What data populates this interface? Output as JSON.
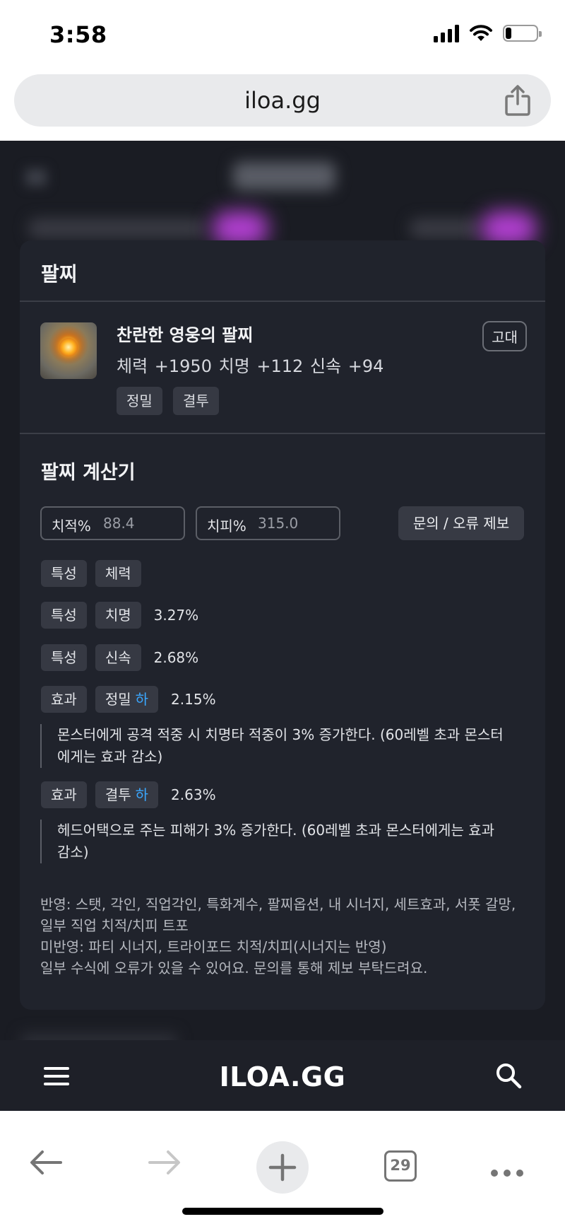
{
  "status_bar": {
    "time": "3:58",
    "battery_level": 0.2
  },
  "browser": {
    "url": "iloa.gg",
    "tab_count": "29"
  },
  "modal": {
    "title": "팔찌",
    "item": {
      "name": "찬란한 영웅의 팔찌",
      "stats": "체력 +1950  치명 +112  신속 +94",
      "grade": "고대",
      "tags": [
        "정밀",
        "결투"
      ]
    },
    "calculator": {
      "title": "팔찌 계산기",
      "crit_rate_label": "치적%",
      "crit_rate_value": "88.4",
      "crit_damage_label": "치피%",
      "crit_damage_value": "315.0",
      "report_button": "문의 / 오류 제보"
    },
    "rows": [
      {
        "type": "특성",
        "name": "체력",
        "value": ""
      },
      {
        "type": "특성",
        "name": "치명",
        "value": "3.27%"
      },
      {
        "type": "특성",
        "name": "신속",
        "value": "2.68%"
      },
      {
        "type": "효과",
        "name": "정밀",
        "grade": "하",
        "value": "2.15%",
        "description": "몬스터에게 공격 적중 시 치명타 적중이 3% 증가한다. (60레벨 초과 몬스터에게는 효과 감소)"
      },
      {
        "type": "효과",
        "name": "결투",
        "grade": "하",
        "value": "2.63%",
        "description": "헤드어택으로 주는 피해가 3% 증가한다. (60레벨 초과 몬스터에게는 효과 감소)"
      }
    ],
    "footnotes": {
      "applied": "반영: 스탯, 각인, 직업각인, 특화계수, 팔찌옵션, 내 시너지, 세트효과, 서폿 갈망, 일부 직업 치적/치피 트포",
      "not_applied": "미반영: 파티 시너지, 트라이포드 치적/치피(시너지는 반영)",
      "error_note": "일부 수식에 오류가 있을 수 있어요. 문의를 통해 제보 부탁드려요."
    }
  },
  "site_nav": {
    "logo": "ILOA.GG"
  },
  "colors": {
    "modal_bg": "#20232c",
    "chip_bg": "#363943",
    "grade_low": "#3aa7ff",
    "page_bg": "#1a1c23"
  },
  "icons": [
    "signal-icon",
    "wifi-icon",
    "battery-icon",
    "share-icon",
    "menu-icon",
    "search-icon",
    "back-icon",
    "forward-icon",
    "plus-icon",
    "tabs-icon",
    "more-icon"
  ]
}
